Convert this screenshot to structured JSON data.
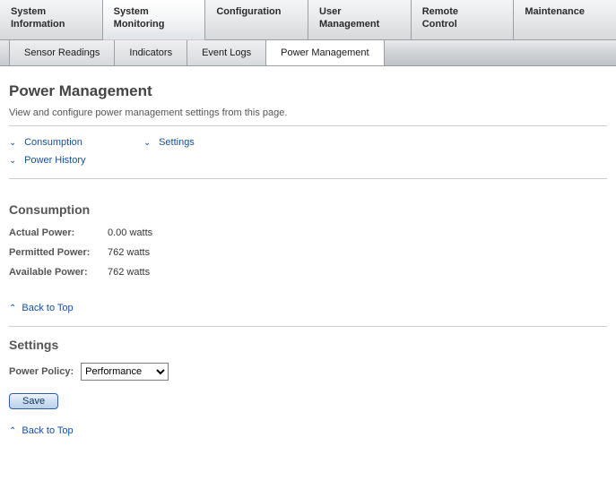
{
  "main_nav": {
    "tabs": [
      {
        "line1": "System",
        "line2": "Information"
      },
      {
        "line1": "System",
        "line2": "Monitoring"
      },
      {
        "line1": "Configuration",
        "line2": ""
      },
      {
        "line1": "User",
        "line2": "Management"
      },
      {
        "line1": "Remote",
        "line2": "Control"
      },
      {
        "line1": "Maintenance",
        "line2": ""
      }
    ],
    "active_index": 1
  },
  "sub_nav": {
    "tabs": [
      "Sensor Readings",
      "Indicators",
      "Event Logs",
      "Power Management"
    ],
    "active_index": 3
  },
  "page": {
    "title": "Power Management",
    "description": "View and configure power management settings from this page."
  },
  "anchor_links": {
    "consumption": "Consumption",
    "settings": "Settings",
    "power_history": "Power History"
  },
  "consumption": {
    "heading": "Consumption",
    "rows": [
      {
        "label": "Actual Power:",
        "value": "0.00 watts"
      },
      {
        "label": "Permitted Power:",
        "value": "762 watts"
      },
      {
        "label": "Available Power:",
        "value": "762 watts"
      }
    ]
  },
  "backtop_label": "Back to Top",
  "settings": {
    "heading": "Settings",
    "policy_label": "Power Policy:",
    "policy_value": "Performance",
    "save_label": "Save"
  }
}
